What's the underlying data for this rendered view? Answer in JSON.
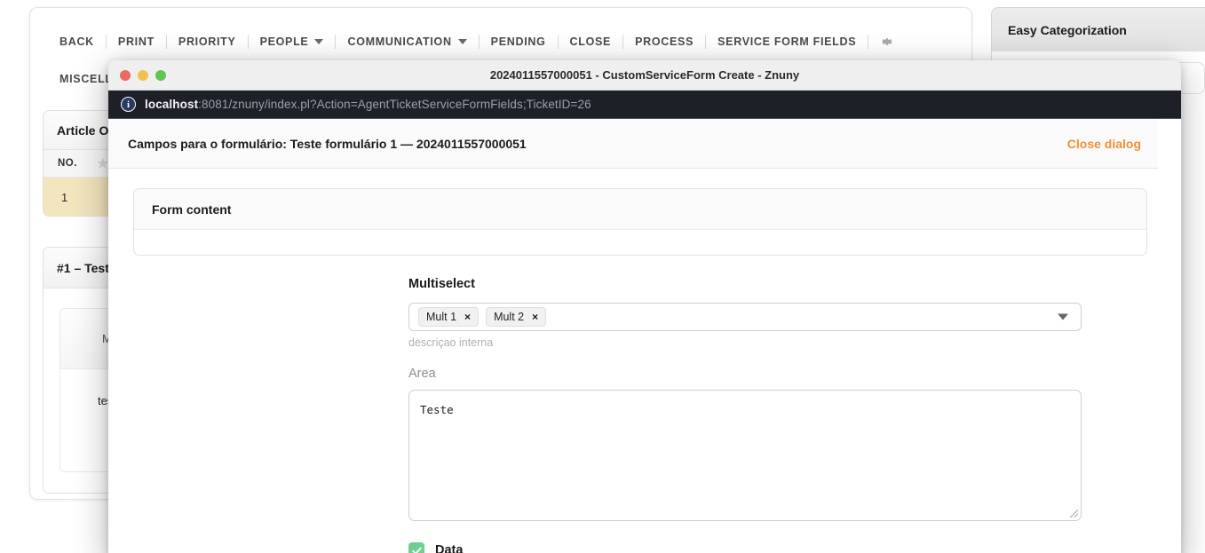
{
  "background": {
    "toolbar": {
      "items": [
        {
          "label": "BACK",
          "has_caret": false
        },
        {
          "label": "PRINT",
          "has_caret": false
        },
        {
          "label": "PRIORITY",
          "has_caret": false
        },
        {
          "label": "PEOPLE",
          "has_caret": true
        },
        {
          "label": "COMMUNICATION",
          "has_caret": true
        },
        {
          "label": "PENDING",
          "has_caret": false
        },
        {
          "label": "CLOSE",
          "has_caret": false
        },
        {
          "label": "PROCESS",
          "has_caret": false
        },
        {
          "label": "SERVICE FORM FIELDS",
          "has_caret": false
        }
      ],
      "gear_icon": "gear-icon"
    },
    "subbar": {
      "label": "MISCELLA"
    },
    "article_overview": {
      "title": "Article O",
      "columns": {
        "no": "NO.",
        "star_icon": "star-icon"
      },
      "row_number": "1"
    },
    "article_detail": {
      "title": "#1 – Test",
      "meta": "Mark",
      "body": "teste"
    },
    "sidebar": {
      "widget_title": "Easy Categorization"
    }
  },
  "window": {
    "title": "2024011557000051 - CustomServiceForm Create - Znuny",
    "traffic_lights": [
      "close-red",
      "minimize-yellow",
      "zoom-green"
    ],
    "url": {
      "info_icon": "info-circle-icon",
      "host": "localhost",
      "rest": ":8081/znuny/index.pl?Action=AgentTicketServiceFormFields;TicketID=26"
    }
  },
  "dialog": {
    "title": "Campos para o formulário: Teste formulário 1 — 2024011557000051",
    "close_label": "Close dialog",
    "panel_title": "Form content",
    "fields": {
      "multiselect": {
        "label": "Multiselect",
        "chips": [
          {
            "label": "Mult 1",
            "remove": "×"
          },
          {
            "label": "Mult 2",
            "remove": "×"
          }
        ],
        "helper": "descriçao interna",
        "arrow_icon": "chevron-down-icon"
      },
      "area": {
        "label": "Area",
        "value": "Teste"
      },
      "checkbox": {
        "label": "Data",
        "checked": true
      }
    }
  },
  "colors": {
    "accent_orange": "#f09135",
    "url_bar_bg": "#1d2027",
    "checkbox_green": "#6ecf92",
    "row_highlight": "#f3e5bd"
  }
}
